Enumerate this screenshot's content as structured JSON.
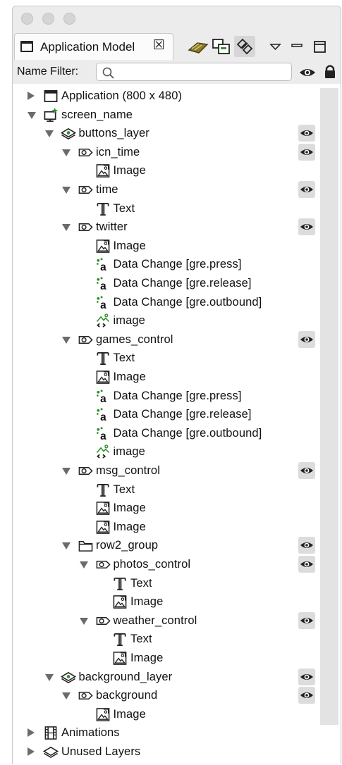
{
  "panel": {
    "tab_title": "Application Model",
    "filter_label": "Name Filter:",
    "filter_value": "",
    "toolbar_icons": [
      "book-icon",
      "collapse-all-icon",
      "link-with-editor-icon",
      "view-menu-icon",
      "minimize-icon",
      "maximize-icon"
    ]
  },
  "tree": [
    {
      "label": "Application (800 x 480)",
      "icon": "application-icon",
      "depth": 0,
      "twisty": "closed",
      "eye": false
    },
    {
      "label": "screen_name",
      "icon": "screen-icon",
      "depth": 0,
      "twisty": "open",
      "eye": false
    },
    {
      "label": "buttons_layer",
      "icon": "layer-icon",
      "depth": 1,
      "twisty": "open",
      "eye": true
    },
    {
      "label": "icn_time",
      "icon": "control-icon",
      "depth": 2,
      "twisty": "open",
      "eye": true
    },
    {
      "label": "Image",
      "icon": "image-icon",
      "depth": 3,
      "twisty": "none",
      "eye": false
    },
    {
      "label": "time",
      "icon": "control-icon",
      "depth": 2,
      "twisty": "open",
      "eye": true
    },
    {
      "label": "Text",
      "icon": "text-icon",
      "depth": 3,
      "twisty": "none",
      "eye": false
    },
    {
      "label": "twitter",
      "icon": "control-icon",
      "depth": 2,
      "twisty": "open",
      "eye": true
    },
    {
      "label": "Image",
      "icon": "image-icon",
      "depth": 3,
      "twisty": "none",
      "eye": false
    },
    {
      "label": "Data Change [gre.press]",
      "icon": "data-change-icon",
      "depth": 3,
      "twisty": "none",
      "eye": false
    },
    {
      "label": "Data Change [gre.release]",
      "icon": "data-change-icon",
      "depth": 3,
      "twisty": "none",
      "eye": false
    },
    {
      "label": "Data Change [gre.outbound]",
      "icon": "data-change-icon",
      "depth": 3,
      "twisty": "none",
      "eye": false
    },
    {
      "label": "image",
      "icon": "external-image-icon",
      "depth": 3,
      "twisty": "none",
      "eye": false
    },
    {
      "label": "games_control",
      "icon": "control-icon",
      "depth": 2,
      "twisty": "open",
      "eye": true
    },
    {
      "label": "Text",
      "icon": "text-icon",
      "depth": 3,
      "twisty": "none",
      "eye": false
    },
    {
      "label": "Image",
      "icon": "image-icon",
      "depth": 3,
      "twisty": "none",
      "eye": false
    },
    {
      "label": "Data Change [gre.press]",
      "icon": "data-change-icon",
      "depth": 3,
      "twisty": "none",
      "eye": false
    },
    {
      "label": "Data Change [gre.release]",
      "icon": "data-change-icon",
      "depth": 3,
      "twisty": "none",
      "eye": false
    },
    {
      "label": "Data Change [gre.outbound]",
      "icon": "data-change-icon",
      "depth": 3,
      "twisty": "none",
      "eye": false
    },
    {
      "label": "image",
      "icon": "external-image-icon",
      "depth": 3,
      "twisty": "none",
      "eye": false
    },
    {
      "label": "msg_control",
      "icon": "control-icon",
      "depth": 2,
      "twisty": "open",
      "eye": true
    },
    {
      "label": "Text",
      "icon": "text-icon",
      "depth": 3,
      "twisty": "none",
      "eye": false
    },
    {
      "label": "Image",
      "icon": "image-icon",
      "depth": 3,
      "twisty": "none",
      "eye": false
    },
    {
      "label": "Image",
      "icon": "image-icon",
      "depth": 3,
      "twisty": "none",
      "eye": false
    },
    {
      "label": "row2_group",
      "icon": "group-icon",
      "depth": 2,
      "twisty": "open",
      "eye": true
    },
    {
      "label": "photos_control",
      "icon": "control-icon",
      "depth": 3,
      "twisty": "open",
      "eye": true
    },
    {
      "label": "Text",
      "icon": "text-icon",
      "depth": 4,
      "twisty": "none",
      "eye": false
    },
    {
      "label": "Image",
      "icon": "image-icon",
      "depth": 4,
      "twisty": "none",
      "eye": false
    },
    {
      "label": "weather_control",
      "icon": "control-icon",
      "depth": 3,
      "twisty": "open",
      "eye": true
    },
    {
      "label": "Text",
      "icon": "text-icon",
      "depth": 4,
      "twisty": "none",
      "eye": false
    },
    {
      "label": "Image",
      "icon": "image-icon",
      "depth": 4,
      "twisty": "none",
      "eye": false
    },
    {
      "label": "background_layer",
      "icon": "layer-icon",
      "depth": 1,
      "twisty": "open",
      "eye": true
    },
    {
      "label": "background",
      "icon": "control-icon",
      "depth": 2,
      "twisty": "open",
      "eye": true
    },
    {
      "label": "Image",
      "icon": "image-icon",
      "depth": 3,
      "twisty": "none",
      "eye": false
    },
    {
      "label": "Animations",
      "icon": "animations-icon",
      "depth": 0,
      "twisty": "closed",
      "eye": false
    },
    {
      "label": "Unused Layers",
      "icon": "unused-layers-icon",
      "depth": 0,
      "twisty": "closed",
      "eye": false
    }
  ]
}
